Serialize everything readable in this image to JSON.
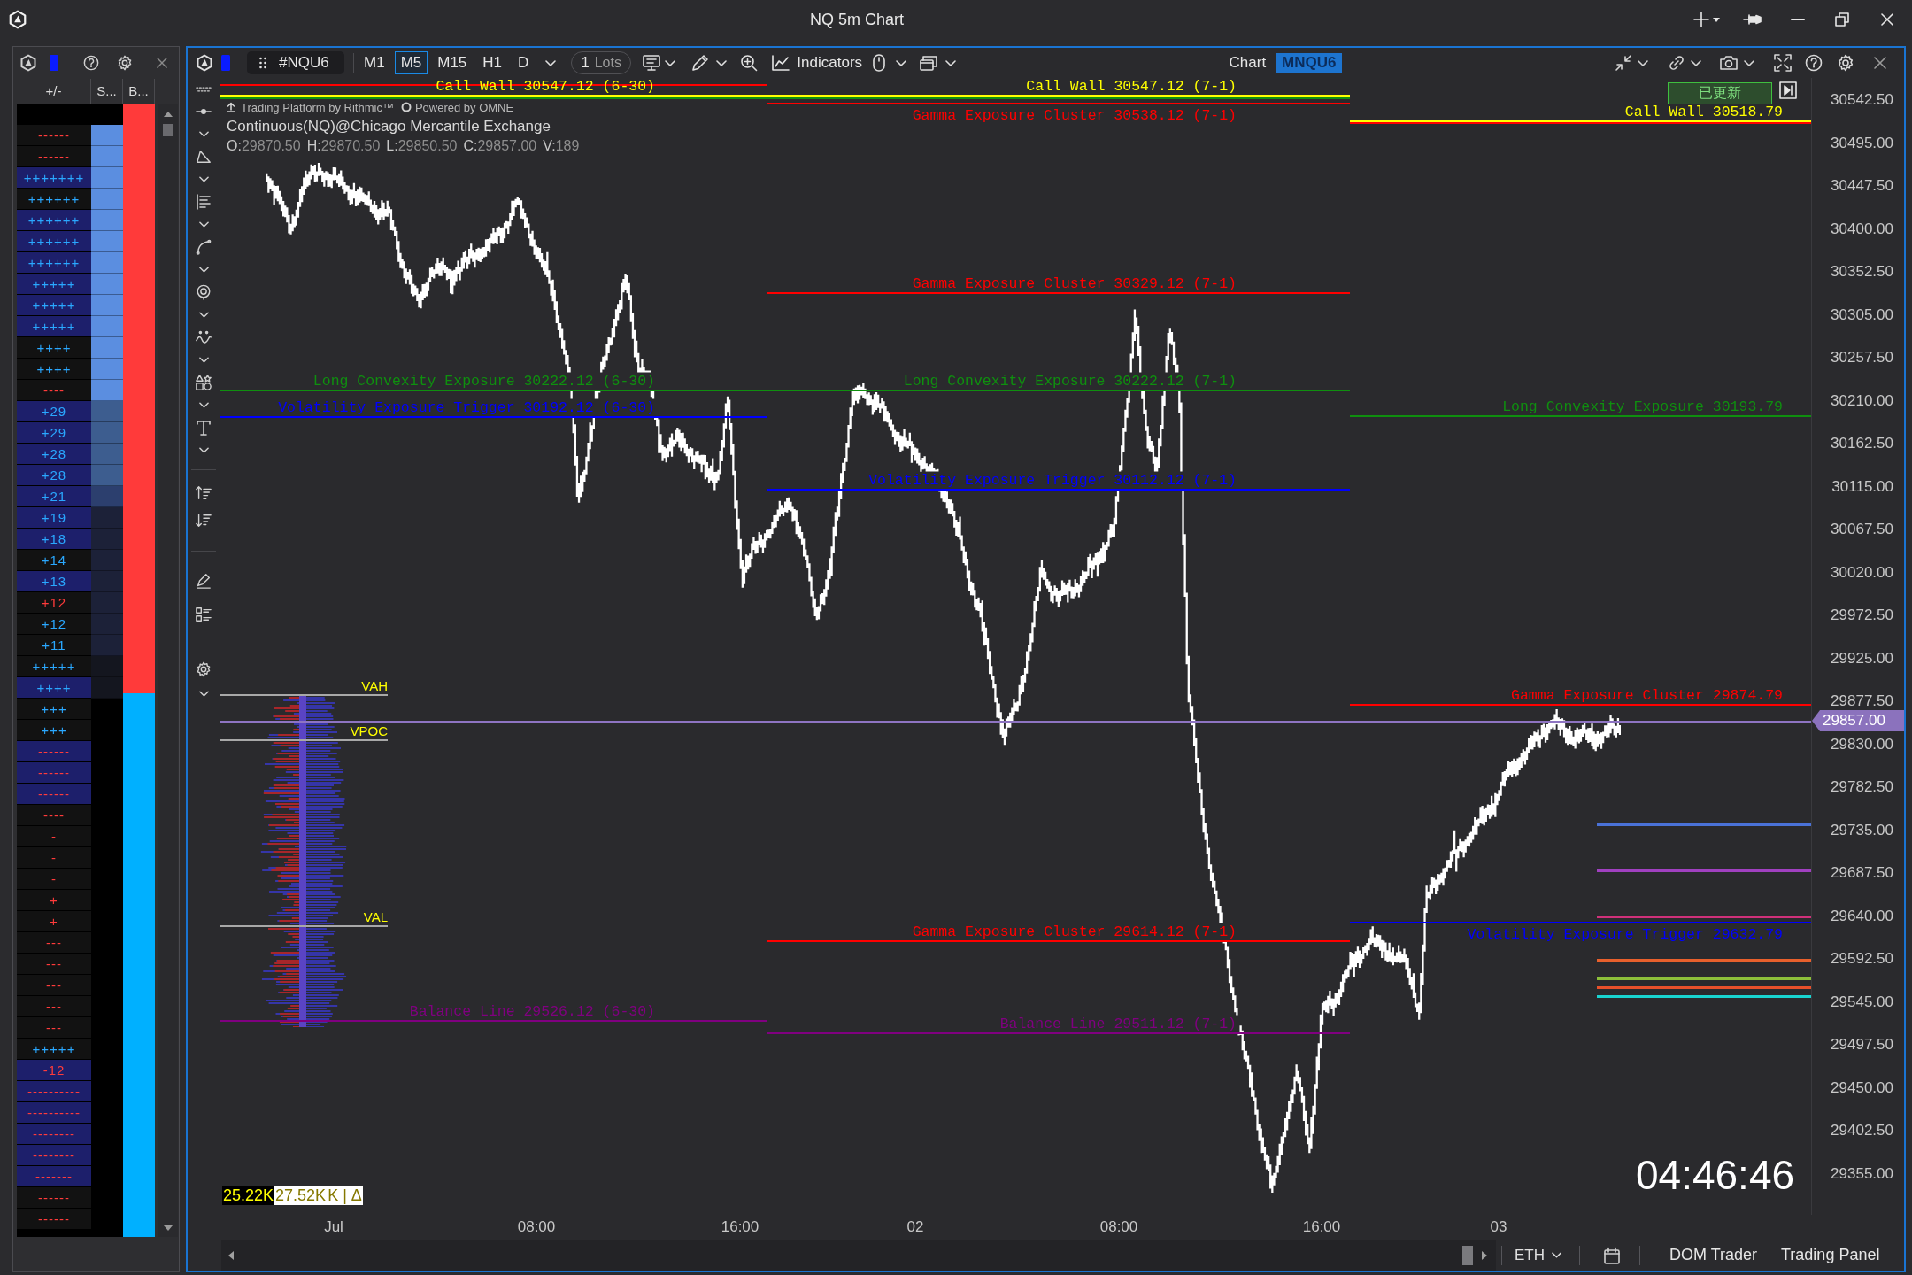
{
  "window": {
    "title": "NQ 5m Chart"
  },
  "dom": {
    "columns": [
      "+/-",
      "S...",
      "B..."
    ],
    "rows": [
      {
        "text": "------",
        "kind": "sell",
        "highlighted": false,
        "s_cell": {
          "color": "#5b8ee0"
        }
      },
      {
        "text": "------",
        "kind": "sell",
        "highlighted": false,
        "s_cell": {
          "color": "#5b8ee0"
        }
      },
      {
        "text": "+++++++",
        "kind": "buy",
        "highlighted": true,
        "s_cell": {
          "color": "#5b8ee0"
        }
      },
      {
        "text": "++++++",
        "kind": "buy",
        "highlighted": false,
        "s_cell": {
          "color": "#5b8ee0"
        }
      },
      {
        "text": "++++++",
        "kind": "buy",
        "highlighted": true,
        "s_cell": {
          "color": "#5b8ee0"
        }
      },
      {
        "text": "++++++",
        "kind": "buy",
        "highlighted": true,
        "s_cell": {
          "color": "#5b8ee0"
        }
      },
      {
        "text": "++++++",
        "kind": "buy",
        "highlighted": true,
        "s_cell": {
          "color": "#5b8ee0"
        }
      },
      {
        "text": "+++++",
        "kind": "buy",
        "highlighted": true,
        "s_cell": {
          "color": "#5b8ee0"
        }
      },
      {
        "text": "+++++",
        "kind": "buy",
        "highlighted": true,
        "s_cell": {
          "color": "#5b8ee0"
        }
      },
      {
        "text": "+++++",
        "kind": "buy",
        "highlighted": true,
        "s_cell": {
          "color": "#5b8ee0"
        }
      },
      {
        "text": "++++",
        "kind": "buy",
        "highlighted": false,
        "s_cell": {
          "color": "#5b8ee0"
        }
      },
      {
        "text": "++++",
        "kind": "buy",
        "highlighted": false,
        "s_cell": {
          "color": "#5b8ee0"
        }
      },
      {
        "text": "----",
        "kind": "sell",
        "highlighted": false,
        "s_cell": {
          "color": "#5b8ee0"
        }
      },
      {
        "text": "+29",
        "kind": "buy",
        "highlighted": true,
        "s_cell": {
          "color": "#3d5d8f"
        }
      },
      {
        "text": "+29",
        "kind": "buy",
        "highlighted": true,
        "s_cell": {
          "color": "#3d5d8f"
        }
      },
      {
        "text": "+28",
        "kind": "buy",
        "highlighted": true,
        "s_cell": {
          "color": "#3d5d8f"
        }
      },
      {
        "text": "+28",
        "kind": "buy",
        "highlighted": true,
        "s_cell": {
          "color": "#3d5d8f"
        }
      },
      {
        "text": "+21",
        "kind": "buy",
        "highlighted": true,
        "s_cell": {
          "color": "#2c3f6e"
        }
      },
      {
        "text": "+19",
        "kind": "buy",
        "highlighted": true,
        "s_cell": {
          "color": "#1c2138"
        }
      },
      {
        "text": "+18",
        "kind": "buy",
        "highlighted": true,
        "s_cell": {
          "color": "#1c2138"
        }
      },
      {
        "text": "+14",
        "kind": "buy",
        "highlighted": false,
        "s_cell": {
          "color": "#1c2138"
        }
      },
      {
        "text": "+13",
        "kind": "buy",
        "highlighted": true,
        "s_cell": {
          "color": "#1c2138"
        }
      },
      {
        "text": "+12",
        "kind": "sell",
        "highlighted": false,
        "s_cell": {
          "color": "#1c2138"
        }
      },
      {
        "text": "+12",
        "kind": "buy",
        "highlighted": false,
        "s_cell": {
          "color": "#1c2138"
        }
      },
      {
        "text": "+11",
        "kind": "buy",
        "highlighted": false,
        "s_cell": {
          "color": "#1c2138"
        }
      },
      {
        "text": "+++++",
        "kind": "buy",
        "highlighted": false,
        "s_cell": {
          "color": "#14161f"
        }
      },
      {
        "text": "++++",
        "kind": "buy",
        "highlighted": true,
        "s_cell": {
          "color": "#14161f"
        }
      },
      {
        "text": "+++",
        "kind": "buy",
        "highlighted": false
      },
      {
        "text": "+++",
        "kind": "buy",
        "highlighted": false
      },
      {
        "text": "------",
        "kind": "sell",
        "highlighted": true
      },
      {
        "text": "------",
        "kind": "sell",
        "highlighted": true
      },
      {
        "text": "------",
        "kind": "sell",
        "highlighted": true
      },
      {
        "text": "----",
        "kind": "sell",
        "highlighted": false
      },
      {
        "text": "-",
        "kind": "sell",
        "highlighted": false
      },
      {
        "text": "-",
        "kind": "sell",
        "highlighted": false
      },
      {
        "text": "-",
        "kind": "sell",
        "highlighted": false
      },
      {
        "text": "+",
        "kind": "sell",
        "highlighted": false
      },
      {
        "text": "+",
        "kind": "sell",
        "highlighted": false
      },
      {
        "text": "---",
        "kind": "sell",
        "highlighted": false
      },
      {
        "text": "---",
        "kind": "sell",
        "highlighted": false
      },
      {
        "text": "---",
        "kind": "sell",
        "highlighted": false
      },
      {
        "text": "---",
        "kind": "sell",
        "highlighted": false
      },
      {
        "text": "---",
        "kind": "sell",
        "highlighted": false
      },
      {
        "text": "+++++",
        "kind": "buy",
        "highlighted": false
      },
      {
        "text": "-12",
        "kind": "sell",
        "highlighted": true
      },
      {
        "text": "----------",
        "kind": "sell",
        "highlighted": true
      },
      {
        "text": "----------",
        "kind": "sell",
        "highlighted": true
      },
      {
        "text": "--------",
        "kind": "sell",
        "highlighted": true
      },
      {
        "text": "--------",
        "kind": "sell",
        "highlighted": true
      },
      {
        "text": "-------",
        "kind": "sell",
        "highlighted": true
      },
      {
        "text": "------",
        "kind": "sell",
        "highlighted": false
      },
      {
        "text": "------",
        "kind": "sell",
        "highlighted": false
      }
    ],
    "b_bar": {
      "level": 0.52
    }
  },
  "chart": {
    "toolbar": {
      "symbol": "#NQU6",
      "timeframes": [
        {
          "label": "M1",
          "selected": false
        },
        {
          "label": "M5",
          "selected": true
        },
        {
          "label": "M15",
          "selected": false
        },
        {
          "label": "H1",
          "selected": false
        },
        {
          "label": "D",
          "selected": false
        }
      ],
      "lots": {
        "value": "1",
        "unit": "Lots"
      },
      "indicators": "Indicators",
      "title": "Chart",
      "symbol_tag": "MNQU6"
    },
    "info": {
      "platform": "Trading Platform by Rithmic™",
      "powered": "Powered by OMNE",
      "instrument": "Continuous(NQ)@Chicago Mercantile Exchange",
      "ohlc": [
        {
          "label": "O:",
          "value": "29870.50"
        },
        {
          "label": "H:",
          "value": "29870.50"
        },
        {
          "label": "L:",
          "value": "29850.50"
        },
        {
          "label": "C:",
          "value": "29857.00"
        },
        {
          "label": "V:",
          "value": "189"
        }
      ]
    },
    "update_button": "已更新",
    "level_lines": [
      {
        "color": "#ff0000"
      },
      {
        "label": "Call Wall 30547.12 (6-30)",
        "color": "#ffff00"
      },
      {
        "color": "#0f8f0f"
      },
      {
        "label": "Call Wall 30547.12 (7-1)",
        "color": "#ffff00"
      },
      {
        "color": "#0f8f0f"
      },
      {
        "label": "Gamma Exposure Cluster 30538.12 (7-1)",
        "color": "#ff0000"
      },
      {
        "label": "Call Wall 30518.79",
        "color": "#ffff00"
      },
      {
        "color": "#ff0000"
      },
      {
        "label": "Gamma Exposure Cluster 30329.12 (7-1)",
        "color": "#ff0000"
      },
      {
        "label": "Long Convexity Exposure 30222.12 (6-30)",
        "color": "#0f8f0f"
      },
      {
        "label": "Long Convexity Exposure 30222.12 (7-1)",
        "color": "#0f8f0f"
      },
      {
        "label": "Volatility Exposure Trigger 30192.12 (6-30)",
        "color": "#0000ff"
      },
      {
        "label": "Long Convexity Exposure 30193.79",
        "color": "#0f8f0f"
      },
      {
        "label": "Volatility Exposure Trigger 30112.12 (7-1)",
        "color": "#0000ff"
      },
      {
        "label": "Gamma Exposure Cluster 29874.79",
        "color": "#ff0000"
      },
      {
        "label": "Gamma Exposure Cluster 29614.12 (7-1)",
        "color": "#ff0000"
      },
      {
        "label": "Volatility Exposure Trigger 29632.79",
        "color": "#0000ff"
      },
      {
        "label": "Balance Line 29526.12 (6-30)",
        "color": "#800080"
      },
      {
        "label": "Balance Line 29511.12 (7-1)",
        "color": "#800080"
      }
    ],
    "marker_lines": [
      {
        "color": "#4a72d8"
      },
      {
        "color": "#a040c0"
      },
      {
        "color": "#d0307a"
      },
      {
        "color": "#e8602c"
      },
      {
        "color": "#8cbf3a"
      },
      {
        "color": "#e8502a"
      },
      {
        "color": "#19d4d0"
      }
    ],
    "current_price": "29857.00",
    "value_area": [
      {
        "label": "VAH"
      },
      {
        "label": "VPOC"
      },
      {
        "label": "VAL"
      }
    ],
    "volume_stats": [
      "25.22K",
      "27.52K",
      "K | Δ"
    ],
    "clock": "04:46:46",
    "price_axis": [
      "30542.50",
      "30495.00",
      "30447.50",
      "30400.00",
      "30352.50",
      "30305.00",
      "30257.50",
      "30210.00",
      "30162.50",
      "30115.00",
      "30067.50",
      "30020.00",
      "29972.50",
      "29925.00",
      "29877.50",
      "29830.00",
      "29782.50",
      "29735.00",
      "29687.50",
      "29640.00",
      "29592.50",
      "29545.00",
      "29497.50",
      "29450.00",
      "29402.50",
      "29355.00"
    ],
    "time_axis": [
      "Jul",
      "08:00",
      "16:00",
      "02",
      "08:00",
      "16:00",
      "03"
    ]
  },
  "bottom_bar": {
    "session": "ETH",
    "buttons": [
      "DOM Trader",
      "Trading Panel"
    ]
  }
}
